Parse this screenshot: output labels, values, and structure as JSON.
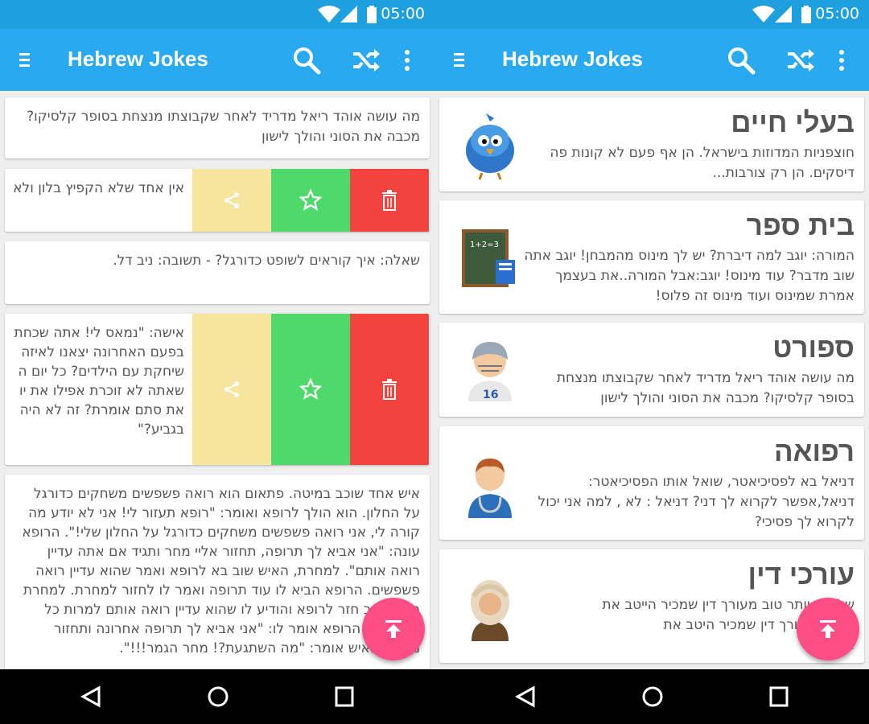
{
  "status": {
    "time": "05:00"
  },
  "app": {
    "title": "Hebrew Jokes"
  },
  "colors": {
    "statusbar": "#1e9fde",
    "appbar": "#29aaf0",
    "fab": "#ff4d88",
    "share": "#f6e59c",
    "favorite": "#4fd96a",
    "delete": "#f2433e"
  },
  "icons": {
    "menu": "menu-icon",
    "search": "search-icon",
    "shuffle": "shuffle-icon",
    "more": "more-vert-icon",
    "share": "share-icon",
    "favorite": "star-icon",
    "delete": "trash-icon",
    "fab": "scroll-to-top-icon"
  },
  "left": {
    "jokes": [
      "מה עושה אוהד ריאל מדריד לאחר שקבוצתו מנצחת בסופר קלסיקו? מכבה את הסוני והולך לישון",
      "אין אחד שלא הקפיץ בלון ולא",
      "שאלה: איך קוראים לשופט כדורגל? - תשובה: ניב דל.",
      "אישה: \"נמאס לי! אתה שכחת\nבפעם האחרונה יצאנו לאיזה\nשיחקת עם הילדים? כל יום ה\nשאתה לא זוכרת אפילו את יו\nאת סתם אומרת? זה לא היה\nבגביע?\"",
      "איש אחד שוכב במיטה. פתאום הוא רואה פשפשים משחקים כדורגל על החלון. הוא הולך לרופא ואומר: \"רופא תעזור לי! אני לא יודע מה קורה לי, אני רואה פשפשים משחקים כדורגל על החלון שלי!\". הרופא עונה: \"אני אביא לך תרופה, תחזור אליי מחר ותגיד אם אתה עדיין רואה אותם\". למחרת, האיש שוב בא לרופא ואמר שהוא עדיין רואה פשפשים. הרופא הביא לו עוד תרופה ואמר לו לחזור למחרת. למחרת האיש שוב חזר לרופא והודיע לו שהוא עדיין רואה אותם למרות כל התרופות. הרופא אומר לו: \"אני אביא לך תרופה אחרונה ותחזור מחר\". האיש אומר: \"מה השתגעת?! מחר הגמר!!!\"."
    ]
  },
  "right": {
    "categories": [
      {
        "title": "בעלי חיים",
        "text": "חוצפניות המדוזות בישראל. הן אף פעם לא קונות פה דיסקים. הן רק צורבות...",
        "icon": "bird-icon"
      },
      {
        "title": "בית ספר",
        "text": "המורה: יוגב למה דיברת? יש לך מינוס מהמבחן! יוגב אתה שוב מדבר? עוד מינוס! יוגב:אבל המורה..את בעצמך אמרת שמינוס ועוד מינוס זה פלוס!",
        "icon": "chalkboard-icon"
      },
      {
        "title": "ספורט",
        "text": "מה עושה אוהד ריאל מדריד לאחר שקבוצתו מנצחת בסופר קלסיקו? מכבה את הסוני והולך לישון",
        "icon": "football-player-icon"
      },
      {
        "title": "רפואה",
        "text": "דניאל בא לפסיכיאטר, שואל אותו הפסיכיאטר: דניאל,אפשר לקרוא לך דני? דניאל : לא , למה אני יכול לקרוא לך פסיכי?",
        "icon": "doctor-icon"
      },
      {
        "title": "עורכי דין",
        "text": "של מה יותר טוב מעורך דין שמכיר הייטב את\nתשובה: עורך דין שמכיר היטב את\n...",
        "icon": "judge-icon"
      }
    ]
  }
}
